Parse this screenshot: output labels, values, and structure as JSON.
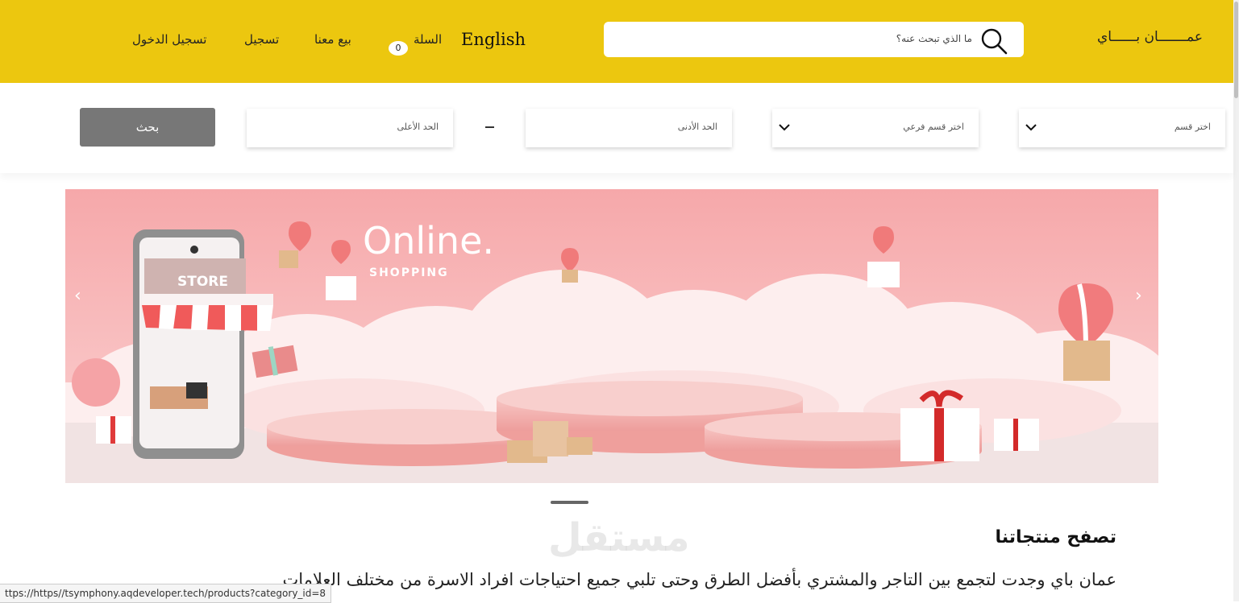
{
  "header": {
    "brand": "عمـــــــان بــــــاي",
    "search_placeholder": "ما الذي تبحث عنه؟",
    "language": "English",
    "cart_label": "السلة",
    "cart_count": "0",
    "sell_label": "بيع معنا",
    "register_label": "تسجيل",
    "login_label": "تسجيل الدخول",
    "colors": {
      "bar": "#ecc70f"
    }
  },
  "filters": {
    "category": "اختر قسم",
    "subcategory": "اختر قسم فرعي",
    "min": "الحد الأدنى",
    "max": "الحد الأعلى",
    "separator": "–",
    "search_button": "بحث"
  },
  "banner": {
    "headline": "Online.",
    "subline": "SHOPPING",
    "store_sign": "STORE",
    "prev_icon": "chevron-left-icon",
    "next_icon": "chevron-right-icon",
    "colors": {
      "background": "#f4b3b3"
    }
  },
  "content": {
    "title": "تصفح منتجاتنا",
    "description": "عمان باي وجدت لتجمع بين التاجر والمشتري بأفضل الطرق وحتى تلبي جميع احتياجات افراد الاسرة من مختلف العلامات",
    "watermark": "مستقل"
  },
  "status_url": "ttps://https//tsymphony.aqdeveloper.tech/products?category_id=8"
}
